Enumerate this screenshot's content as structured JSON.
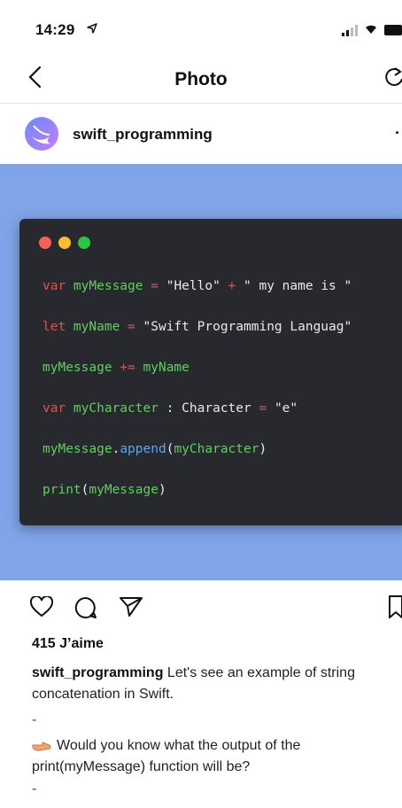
{
  "status_bar": {
    "time": "14:29"
  },
  "nav": {
    "title": "Photo"
  },
  "post": {
    "username": "swift_programming",
    "more": "·",
    "code_lines": [
      [
        {
          "t": "var",
          "c": "kw"
        },
        {
          "t": " myMessage",
          "c": "vr"
        },
        {
          "t": " = ",
          "c": "op"
        },
        {
          "t": "\"Hello\"",
          "c": "str"
        },
        {
          "t": " + ",
          "c": "op"
        },
        {
          "t": "\" my name is \"",
          "c": "str"
        }
      ],
      [
        {
          "t": "let",
          "c": "kw"
        },
        {
          "t": " myName",
          "c": "vr"
        },
        {
          "t": " = ",
          "c": "op"
        },
        {
          "t": "\"Swift Programming Languag\"",
          "c": "str"
        }
      ],
      [
        {
          "t": "myMessage",
          "c": "vr"
        },
        {
          "t": " += ",
          "c": "op"
        },
        {
          "t": "myName",
          "c": "vr"
        }
      ],
      [
        {
          "t": "var",
          "c": "kw"
        },
        {
          "t": " myCharacter",
          "c": "vr"
        },
        {
          "t": " : ",
          "c": "plain"
        },
        {
          "t": "Character",
          "c": "plain"
        },
        {
          "t": " = ",
          "c": "op"
        },
        {
          "t": "\"e\"",
          "c": "str"
        }
      ],
      [
        {
          "t": "myMessage",
          "c": "vr"
        },
        {
          "t": ".",
          "c": "plain"
        },
        {
          "t": "append",
          "c": "fn"
        },
        {
          "t": "(",
          "c": "plain"
        },
        {
          "t": "myCharacter",
          "c": "vr"
        },
        {
          "t": ")",
          "c": "plain"
        }
      ],
      [
        {
          "t": "print",
          "c": "vr"
        },
        {
          "t": "(",
          "c": "plain"
        },
        {
          "t": "myMessage",
          "c": "vr"
        },
        {
          "t": ")",
          "c": "plain"
        }
      ]
    ],
    "likes": "415 J’aime",
    "caption_user": "swift_programming",
    "caption_text": " Let's see an example of string concatenation in Swift.",
    "dash": "-",
    "question": "Would you know what the output of the print(myMessage) function will be?",
    "dash2": "-"
  },
  "colors": {
    "post_background": "#7fa5e8",
    "code_background": "#27292f",
    "dot_red": "#fc5f57",
    "dot_yellow": "#fdbc2e",
    "dot_green": "#28c840"
  }
}
